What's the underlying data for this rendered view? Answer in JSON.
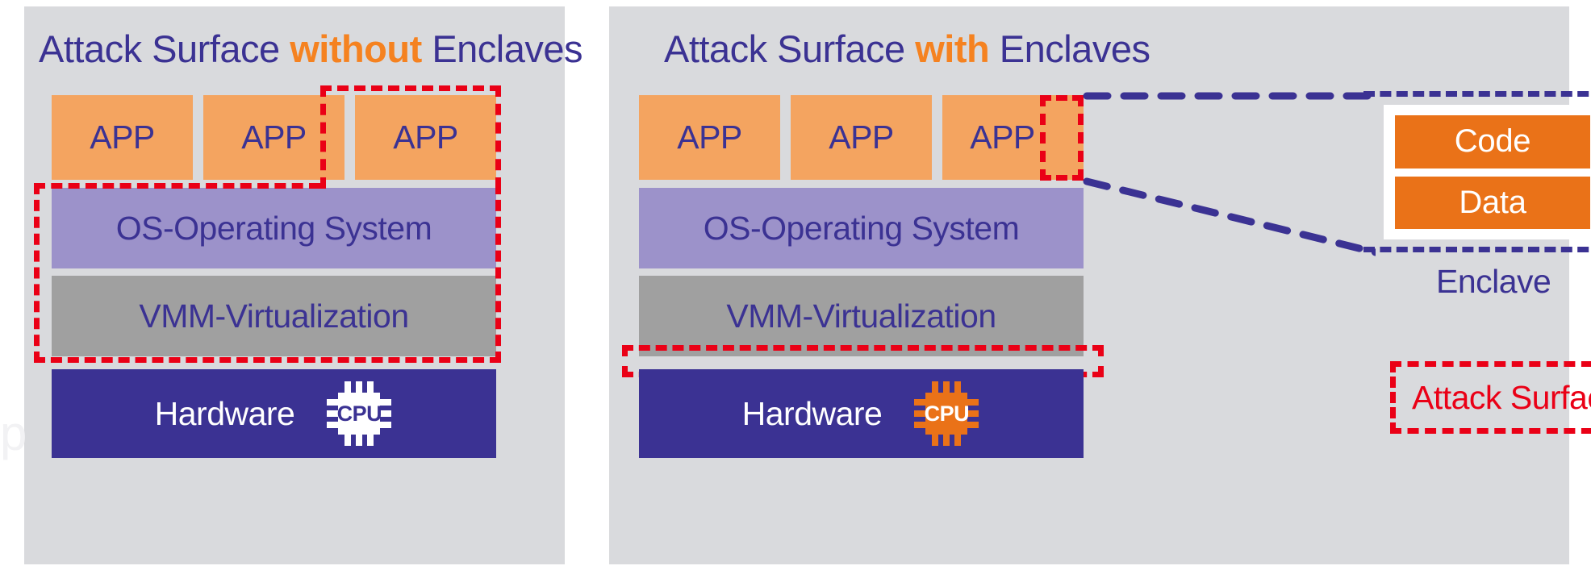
{
  "figure": {
    "watermark": "p"
  },
  "colors": {
    "panel_bg": "#d9dadd",
    "navy": "#3b3293",
    "orange_accent": "#f58220",
    "app_fill": "#f4a460",
    "os_fill": "#9c92ca",
    "vmm_fill": "#a0a0a0",
    "hardware_fill": "#3b3293",
    "attack_red": "#ea0016",
    "enclave_bar": "#ea7218"
  },
  "left_panel": {
    "title_prefix": "Attack Surface ",
    "title_highlight": "without",
    "title_suffix": " Enclaves",
    "apps": [
      "APP",
      "APP",
      "APP"
    ],
    "os_label": "OS-Operating System",
    "vmm_label": "VMM-Virtualization",
    "hardware_label": "Hardware",
    "cpu_label": "CPU"
  },
  "right_panel": {
    "title_prefix": "Attack Surface ",
    "title_highlight": "with",
    "title_suffix": " Enclaves",
    "apps": [
      "APP",
      "APP",
      "APP"
    ],
    "os_label": "OS-Operating System",
    "vmm_label": "VMM-Virtualization",
    "hardware_label": "Hardware",
    "cpu_label": "CPU",
    "enclave": {
      "code_label": "Code",
      "data_label": "Data",
      "caption": "Enclave",
      "lock_icon": "padlock-icon"
    },
    "legend": {
      "attack_surface_label": "Attack Surface"
    }
  }
}
